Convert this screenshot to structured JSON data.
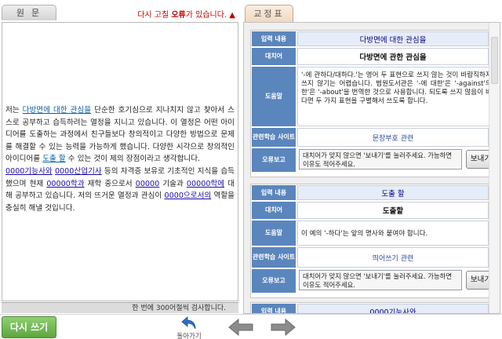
{
  "left": {
    "tab_label": "원문",
    "error_note_prefix": "다시 고칠 ",
    "error_note_bold": "오류",
    "error_note_suffix": "가 있습니다. ▲",
    "essay": {
      "s1": "저는 ",
      "e1": "다방면에 대한 관심을",
      "s2": " 단순한 호기심으로 지나치지 않고 찾아서 스스로 공부하고 습득하려는 열정을 지니고 있습니다. 이 열정은 어떤 아이디어를 도출하는 과정에서 친구들보다 창의적이고 다양한 방법으로 문제를 해결할 수 있는 능력을 가능하게 했습니다. 다양한 시각으로 창의적인 아이디어를 ",
      "e2": "도출 할",
      "s3": " 수 있는 것이 제의 장점이라고 생각합니다.",
      "e3": "0000기능사와",
      "s4": " ",
      "e4": "0000산업기사",
      "s5": " 등의 자격증 보유로 기초적인 지식을 습득했으며 현재 ",
      "e5": "00000학과",
      "s6": " 재학 중으로서 ",
      "e6": "00000",
      "s7": " 기술과 ",
      "e7": "00000학에",
      "s8": " 대해 공부하고 있습니다. 저의 뜨거운 열정과 관심이 ",
      "e8": "0000으로서의",
      "s9": " 역할을 충실히 해낼 것입니다."
    },
    "counter": "한 번에 300어절씩 검사합니다."
  },
  "right": {
    "tab_label": "교정표",
    "labels": {
      "input": "입력 내용",
      "replace": "대치어",
      "help": "도움말",
      "related": "관련학습 사이트",
      "report": "오류보고"
    },
    "cards": [
      {
        "input": "다방면에 대한 관심을",
        "replace": "다방면에 관한 관심을",
        "help": "'-에 관하다/대하다.'는 영어 두 표현으로 쓰지 않는 것이 바람직하지만, 현실적으로 쓰지 않기는 어렵습니다. 범원도서관은 '-에 대한'은 '-against'의 번역, '-에 관한'은 '-about'을 번역한 것으로 사용합니다. 되도록 쓰지 않음이 바람직하지만, 쓴다면 두 가지 표현을 구별해서 쓰도록 합니다.",
        "related": "문장부호 관련",
        "report_text": "대치어가 맞지 않으면 '보내기'를 눌러주세요. 가능하면 이유도 적어주세요.",
        "send": "보내기"
      },
      {
        "input": "도출 할",
        "replace": "도출할",
        "help": "이 예의 '-하다'는 앞의 명사와 붙여야 합니다.",
        "related": "띄어쓰기 관련",
        "report_text": "대치어가 맞지 않으면 '보내기'를 눌러주세요. 가능하면 이유도 적어주세요.",
        "send": "보내기"
      },
      {
        "input": "0000기능사와"
      }
    ]
  },
  "bottom": {
    "rewrite": "다시 쓰기",
    "back": "돌아가기"
  },
  "colors": {
    "label_bg": "#5b86bd",
    "input_bg": "#e6ecf8",
    "error_red": "#c00000",
    "rewrite_green": "#6fb24e"
  }
}
